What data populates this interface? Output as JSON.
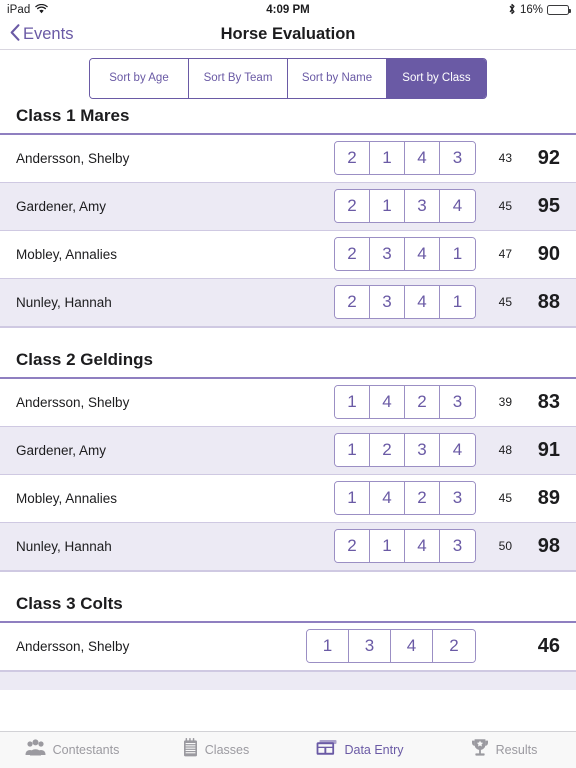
{
  "status_bar": {
    "device": "iPad",
    "wifi_icon": "wifi-icon",
    "time": "4:09 PM",
    "bluetooth_icon": "bluetooth-icon",
    "battery_percent": "16%",
    "battery_level": 16
  },
  "nav_bar": {
    "back_icon": "chevron-left-icon",
    "back_label": "Events",
    "title": "Horse Evaluation"
  },
  "sort_control": {
    "options": [
      {
        "label": "Sort by Age",
        "active": false
      },
      {
        "label": "Sort By Team",
        "active": false
      },
      {
        "label": "Sort by Name",
        "active": false
      },
      {
        "label": "Sort by Class",
        "active": true
      }
    ]
  },
  "colors": {
    "accent_purple": "#6A5AA5",
    "row_alt": "#eceaf4",
    "rule": "#8F7FC0",
    "border_light": "#cfc9e2"
  },
  "sections": [
    {
      "title": "Class 1 Mares",
      "rows": [
        {
          "name": "Andersson, Shelby",
          "placings": [
            "2",
            "1",
            "4",
            "3"
          ],
          "age": "43",
          "score": "92"
        },
        {
          "name": "Gardener, Amy",
          "placings": [
            "2",
            "1",
            "3",
            "4"
          ],
          "age": "45",
          "score": "95"
        },
        {
          "name": "Mobley, Annalies",
          "placings": [
            "2",
            "3",
            "4",
            "1"
          ],
          "age": "47",
          "score": "90"
        },
        {
          "name": "Nunley, Hannah",
          "placings": [
            "2",
            "3",
            "4",
            "1"
          ],
          "age": "45",
          "score": "88"
        }
      ]
    },
    {
      "title": "Class 2 Geldings",
      "rows": [
        {
          "name": "Andersson, Shelby",
          "placings": [
            "1",
            "4",
            "2",
            "3"
          ],
          "age": "39",
          "score": "83"
        },
        {
          "name": "Gardener, Amy",
          "placings": [
            "1",
            "2",
            "3",
            "4"
          ],
          "age": "48",
          "score": "91"
        },
        {
          "name": "Mobley, Annalies",
          "placings": [
            "1",
            "4",
            "2",
            "3"
          ],
          "age": "45",
          "score": "89"
        },
        {
          "name": "Nunley, Hannah",
          "placings": [
            "2",
            "1",
            "4",
            "3"
          ],
          "age": "50",
          "score": "98"
        }
      ]
    },
    {
      "title": "Class 3 Colts",
      "rows": [
        {
          "name": "Andersson, Shelby",
          "placings": [
            "1",
            "3",
            "4",
            "2"
          ],
          "age": "",
          "score": "46",
          "wide": true
        }
      ]
    }
  ],
  "tab_bar": {
    "tabs": [
      {
        "label": "Contestants",
        "icon": "people-group-icon",
        "active": false
      },
      {
        "label": "Classes",
        "icon": "notepad-icon",
        "active": false
      },
      {
        "label": "Data Entry",
        "icon": "grid-form-icon",
        "active": true
      },
      {
        "label": "Results",
        "icon": "trophy-icon",
        "active": false
      }
    ]
  }
}
